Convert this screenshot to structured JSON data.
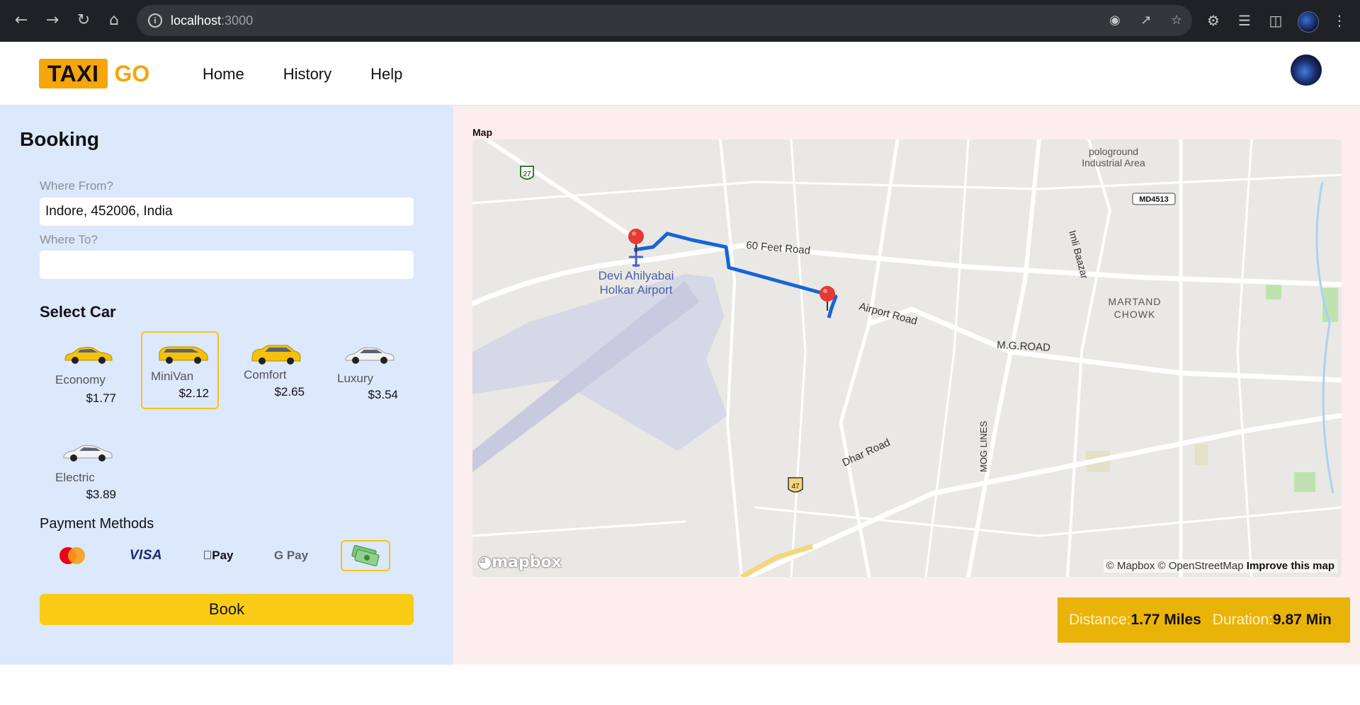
{
  "browser": {
    "url_host": "localhost",
    "url_port": ":3000"
  },
  "header": {
    "logo_taxi": "TAXI",
    "logo_go": "GO",
    "nav": [
      "Home",
      "History",
      "Help"
    ]
  },
  "booking": {
    "title": "Booking",
    "from_label": "Where From?",
    "from_value": "Indore, 452006, India",
    "to_label": "Where To?",
    "to_value": "",
    "select_car_label": "Select Car",
    "cars": [
      {
        "name": "Economy",
        "price": "$1.77",
        "color": "#f4c20d",
        "selected": false
      },
      {
        "name": "MiniVan",
        "price": "$2.12",
        "color": "#f4c20d",
        "selected": true
      },
      {
        "name": "Comfort",
        "price": "$2.65",
        "color": "#f4c20d",
        "selected": false
      },
      {
        "name": "Luxury",
        "price": "$3.54",
        "color": "#ffffff",
        "selected": false
      },
      {
        "name": "Electric",
        "price": "$3.89",
        "color": "#ffffff",
        "selected": false
      }
    ],
    "payment_label": "Payment Methods",
    "payments": [
      "mastercard-icon",
      "VISA",
      "Pay",
      "G Pay",
      "cash-icon"
    ],
    "book_label": "Book"
  },
  "map": {
    "label": "Map",
    "attribution_mapbox": "© Mapbox",
    "attribution_osm": "© OpenStreetMap",
    "improve": "Improve this map",
    "logo": "mapbox",
    "places": {
      "airport_line1": "Devi Ahilyabai",
      "airport_line2": "Holkar Airport",
      "road_60": "60 Feet Road",
      "road_airport": "Airport Road",
      "road_mg": "M.G.ROAD",
      "road_dhar": "Dhar Road",
      "road_imli": "Imli Baazar",
      "road_mog": "MOG LINES",
      "area_polo1": "pologround",
      "area_polo2": "Industrial Area",
      "area_martand1": "MARTAND",
      "area_martand2": "CHOWK",
      "shield_27": "27",
      "shield_47": "47",
      "shield_md": "MD4513"
    }
  },
  "stats": {
    "distance_label": "Distance:",
    "distance_value": "1.77 Miles",
    "duration_label": "Duration:",
    "duration_value": "9.87 Min"
  },
  "colors": {
    "brand": "#f5a60b",
    "book_button": "#facc15",
    "route": "#1565d8",
    "marker": "#e53935"
  }
}
